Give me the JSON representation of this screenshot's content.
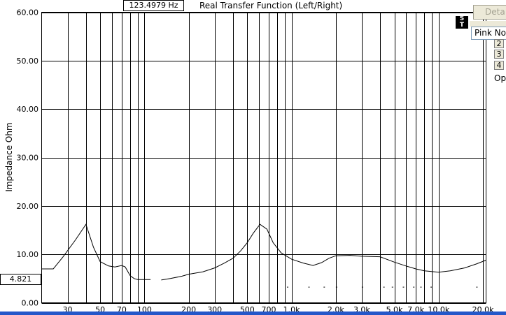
{
  "header": {
    "frequency_readout": "123.4979 Hz",
    "title": "Real Transfer Function (Left/Right)"
  },
  "cursor": {
    "value_readout": "4.821"
  },
  "right_panel": {
    "details_label": "Deta",
    "logo_text": "S T",
    "signal_select_value": "Pink No",
    "channel_buttons": [
      "2",
      "3",
      "4"
    ],
    "options_label": "Op"
  },
  "colors": {
    "background": "#ffffff",
    "grid": "#000000",
    "trace": "#000000",
    "panel": "#ece9d8",
    "taskbar": "#2457c9"
  },
  "chart_data": {
    "type": "line",
    "title": "Real Transfer Function (Left/Right)",
    "xlabel": "",
    "ylabel": "Impedance Ohm",
    "x_scale": "log",
    "xlim": [
      20,
      21000
    ],
    "ylim": [
      0,
      60
    ],
    "grid": true,
    "y_ticks": [
      0,
      10,
      20,
      30,
      40,
      50,
      60
    ],
    "y_tick_labels": [
      "0.00",
      "10.00",
      "20.00",
      "30.00",
      "40.00",
      "50.00",
      "60.00"
    ],
    "x_ticks": [
      30,
      50,
      70,
      100,
      200,
      300,
      500,
      700,
      1000,
      2000,
      3000,
      5000,
      7000,
      10000,
      20000
    ],
    "x_tick_labels": [
      "30",
      "50",
      "70",
      "100",
      "200",
      "300",
      "500",
      "700",
      "1.0k",
      "2.0k",
      "3.0k",
      "5.0k",
      "7.0k",
      "10.0k",
      "20.0k"
    ],
    "x_gridlines": [
      30,
      40,
      50,
      60,
      70,
      80,
      90,
      100,
      200,
      300,
      400,
      500,
      600,
      700,
      800,
      900,
      1000,
      2000,
      3000,
      4000,
      5000,
      6000,
      7000,
      8000,
      9000,
      10000,
      20000
    ],
    "series": [
      {
        "segments": [
          [
            [
              20,
              7.0
            ],
            [
              24,
              7.0
            ],
            [
              28,
              9.5
            ],
            [
              34,
              13.0
            ],
            [
              40,
              16.2
            ],
            [
              45,
              11.5
            ],
            [
              50,
              8.5
            ],
            [
              57,
              7.6
            ],
            [
              63,
              7.4
            ],
            [
              70,
              7.7
            ],
            [
              74,
              7.4
            ],
            [
              80,
              5.6
            ],
            [
              85,
              5.0
            ],
            [
              90,
              4.8
            ],
            [
              100,
              4.8
            ],
            [
              110,
              4.8
            ]
          ],
          [
            [
              130,
              4.7
            ],
            [
              150,
              5.0
            ],
            [
              180,
              5.5
            ],
            [
              200,
              5.9
            ],
            [
              250,
              6.4
            ],
            [
              300,
              7.2
            ],
            [
              350,
              8.2
            ],
            [
              400,
              9.2
            ],
            [
              450,
              10.7
            ],
            [
              500,
              12.4
            ],
            [
              550,
              14.4
            ],
            [
              610,
              16.2
            ],
            [
              680,
              15.2
            ],
            [
              750,
              12.4
            ],
            [
              850,
              10.3
            ],
            [
              1000,
              9.0
            ],
            [
              1200,
              8.2
            ],
            [
              1400,
              7.7
            ],
            [
              1600,
              8.3
            ],
            [
              1800,
              9.2
            ],
            [
              2000,
              9.7
            ],
            [
              2500,
              9.8
            ],
            [
              3000,
              9.6
            ],
            [
              4000,
              9.5
            ],
            [
              5000,
              8.4
            ],
            [
              6000,
              7.6
            ],
            [
              7000,
              7.0
            ],
            [
              8000,
              6.6
            ],
            [
              10000,
              6.3
            ],
            [
              12000,
              6.6
            ],
            [
              15000,
              7.2
            ],
            [
              18000,
              8.0
            ],
            [
              21000,
              8.8
            ]
          ]
        ]
      }
    ],
    "scatter_marks": [
      [
        930,
        3.3
      ],
      [
        1300,
        3.3
      ],
      [
        1650,
        3.3
      ],
      [
        2000,
        3.3
      ],
      [
        3000,
        3.3
      ],
      [
        4200,
        3.3
      ],
      [
        4800,
        3.3
      ],
      [
        5700,
        3.3
      ],
      [
        6700,
        3.3
      ],
      [
        7500,
        3.3
      ],
      [
        8800,
        3.3
      ],
      [
        18000,
        3.3
      ]
    ]
  }
}
